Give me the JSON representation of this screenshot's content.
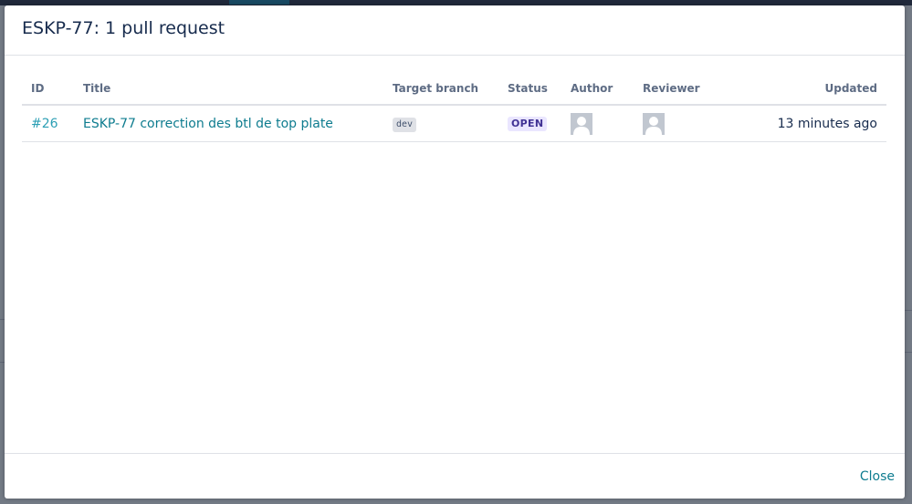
{
  "modal": {
    "title": "ESKP-77: 1 pull request",
    "close_label": "Close"
  },
  "table": {
    "columns": {
      "id": "ID",
      "title": "Title",
      "target_branch": "Target branch",
      "status": "Status",
      "author": "Author",
      "reviewer": "Reviewer",
      "updated": "Updated"
    },
    "rows": [
      {
        "id": "#26",
        "title": "ESKP-77 correction des btl de top plate",
        "target_branch": "dev",
        "status": "OPEN",
        "author_avatar": "default-user-avatar",
        "reviewer_avatar": "default-user-avatar",
        "updated": "13 minutes ago"
      }
    ]
  },
  "colors": {
    "link": "#0e7c8f",
    "status_bg": "#eae6ff",
    "status_text": "#403294",
    "header_text": "#5e6c84"
  }
}
